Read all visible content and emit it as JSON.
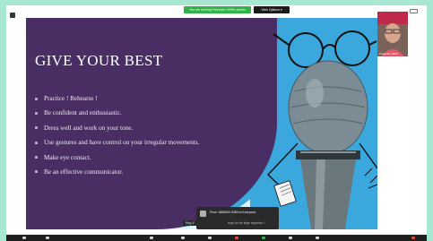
{
  "share_bar": {
    "status_text": "You are viewing Presenter 3999's screen",
    "view_options_label": "View Options ▾"
  },
  "slide": {
    "title": "GIVE YOUR BEST",
    "bullets": [
      "Practice ! Rehearse !",
      "Be confident and enthusiastic.",
      "Dress well and work on your tone.",
      "Use gestures and have control on your irregular movements.",
      "Make eye contact.",
      "Be an effective communicator."
    ]
  },
  "webcam": {
    "label": "Presenter 3999"
  },
  "chat": {
    "sender_label": "Reg V",
    "title": "From 1685600 2089 to Everyone",
    "message": "reply for the large response 1"
  },
  "colors": {
    "slide_left": "#482e62",
    "slide_right": "#3aa8dd",
    "share_green": "#2fb44a",
    "app_border": "#a8e8d2"
  },
  "icons": {
    "grid": "grid-icon",
    "view": "view-icon"
  }
}
